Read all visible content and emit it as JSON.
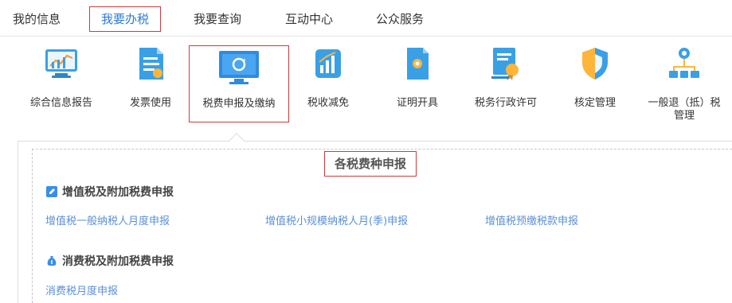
{
  "nav": {
    "tabs": [
      "我的信息",
      "我要办税",
      "我要查询",
      "互动中心",
      "公众服务"
    ]
  },
  "icons": [
    {
      "label": "综合信息报告",
      "icon": "report-chart-icon"
    },
    {
      "label": "发票使用",
      "icon": "invoice-icon"
    },
    {
      "label": "税费申报及缴纳",
      "icon": "monitor-refresh-icon"
    },
    {
      "label": "税收减免",
      "icon": "bar-chart-icon"
    },
    {
      "label": "证明开具",
      "icon": "certificate-doc-icon"
    },
    {
      "label": "税务行政许可",
      "icon": "license-certificate-icon"
    },
    {
      "label": "核定管理",
      "icon": "shield-icon"
    },
    {
      "label": "一般退（抵）税",
      "label2": "管理",
      "icon": "org-tree-icon"
    }
  ],
  "section": {
    "title": "各税费种申报",
    "groups": [
      {
        "title": "增值税及附加税费申报",
        "links": [
          "增值税一般纳税人月度申报",
          "增值税小规模纳税人月(季)申报",
          "增值税预缴税款申报"
        ]
      },
      {
        "title": "消费税及附加税费申报",
        "links": [
          "消费税月度申报"
        ]
      }
    ]
  },
  "colors": {
    "accent": "#2b7bd6",
    "highlight_border": "#d03a3a",
    "link": "#5b8fd6"
  }
}
